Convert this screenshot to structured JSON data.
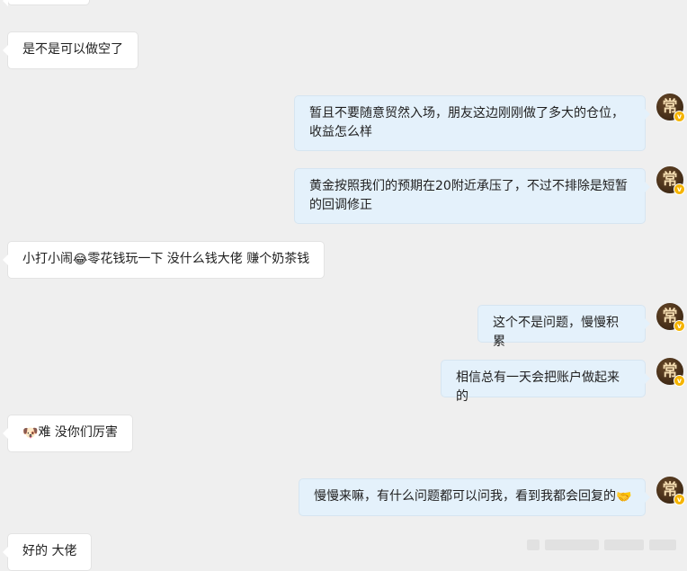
{
  "messages": [
    {
      "side": "left",
      "text": "是不是可以做空了"
    },
    {
      "side": "right",
      "text": "暂且不要随意贸然入场，朋友这边刚刚做了多大的仓位，收益怎么样"
    },
    {
      "side": "right",
      "text": "黄金按照我们的预期在20附近承压了，不过不排除是短暂的回调修正"
    },
    {
      "side": "left",
      "text_before": "小打小闹",
      "emoji": "😂",
      "text_after": "零花钱玩一下 没什么钱大佬 赚个奶茶钱"
    },
    {
      "side": "right",
      "text": "这个不是问题，慢慢积累"
    },
    {
      "side": "right",
      "text": "相信总有一天会把账户做起来的"
    },
    {
      "side": "left",
      "emoji": "🐶",
      "text_after": "难 没你们厉害"
    },
    {
      "side": "right",
      "text_before": "慢慢来嘛，有什么问题都可以问我，看到我都会回复的",
      "emoji": "🤝"
    },
    {
      "side": "left",
      "text": "好的 大佬"
    }
  ],
  "avatar": {
    "glyph": "常",
    "badge": "v",
    "icon": "user-avatar-icon"
  },
  "colors": {
    "background": "#efefef",
    "left_bubble": "#ffffff",
    "right_bubble": "#e4f1fb",
    "badge": "#f5b400"
  }
}
